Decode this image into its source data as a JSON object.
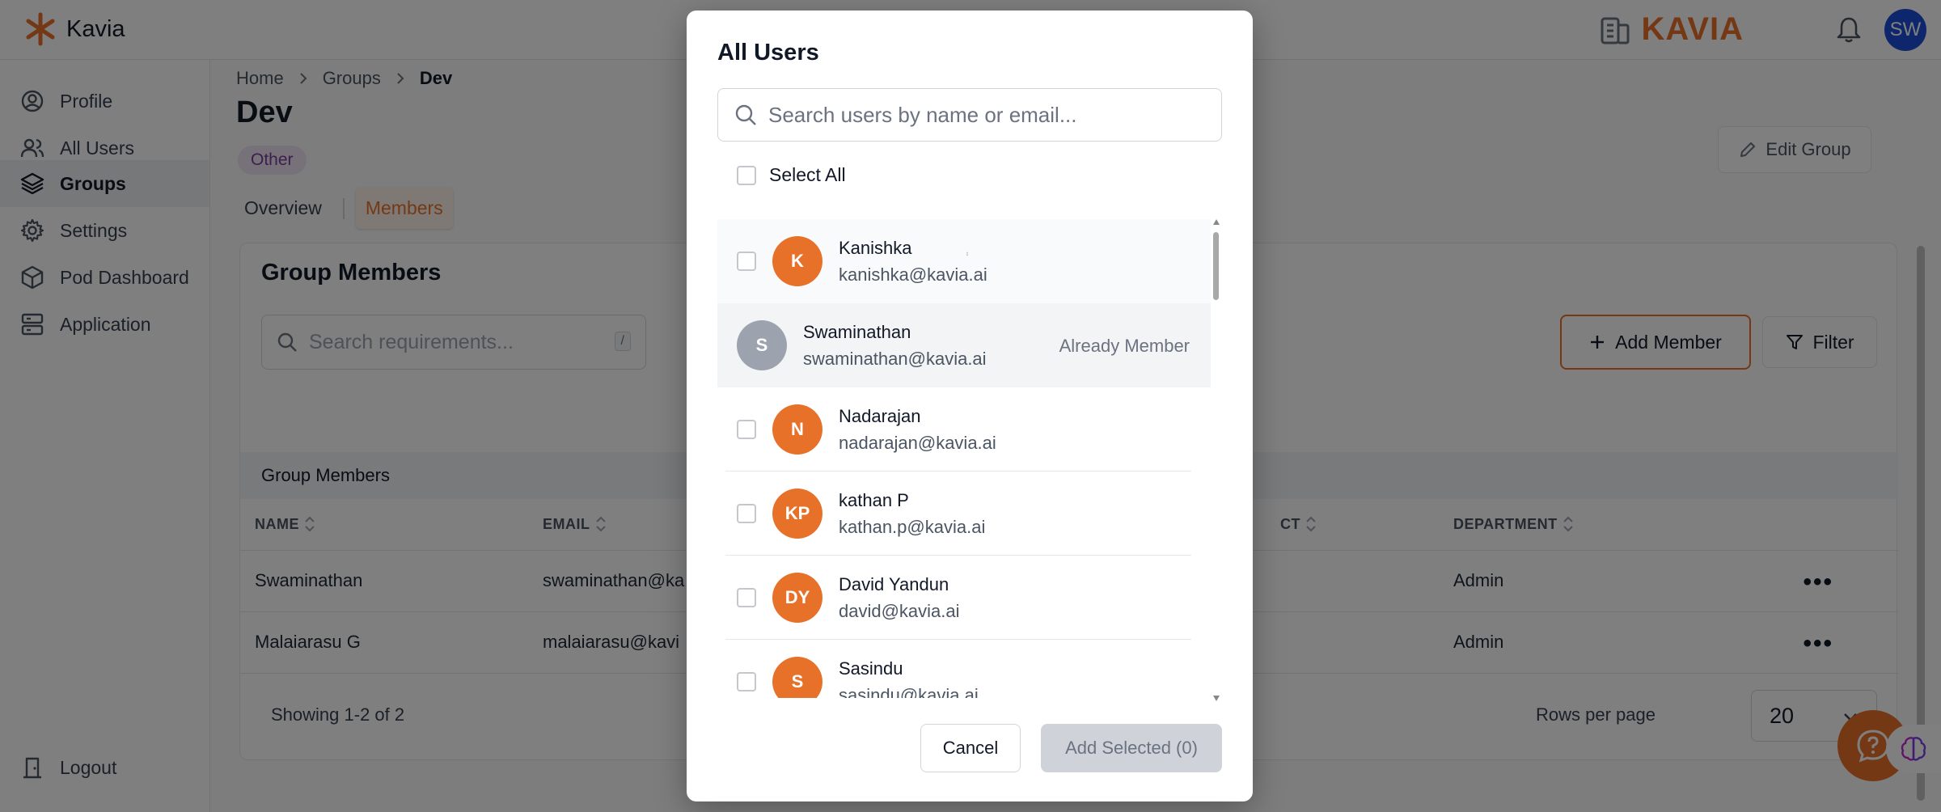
{
  "topbar": {
    "brand": "Kavia",
    "logo_text": "KAVIA",
    "avatar_initials": "SW"
  },
  "sidebar": {
    "items": [
      {
        "label": "Profile",
        "icon": "user-circle-icon"
      },
      {
        "label": "All Users",
        "icon": "users-icon"
      },
      {
        "label": "Groups",
        "icon": "layers-icon",
        "active": true
      },
      {
        "label": "Settings",
        "icon": "gear-icon"
      },
      {
        "label": "Pod Dashboard",
        "icon": "cube-icon"
      },
      {
        "label": "Application",
        "icon": "server-icon"
      }
    ],
    "logout": "Logout"
  },
  "breadcrumb": [
    "Home",
    "Groups",
    "Dev"
  ],
  "page": {
    "title": "Dev",
    "tag": "Other",
    "edit_label": "Edit Group",
    "tabs": [
      "Overview",
      "Members"
    ]
  },
  "members": {
    "title": "Group Members",
    "search_placeholder": "Search requirements...",
    "search_kbd": "/",
    "add_label": "Add Member",
    "filter_label": "Filter",
    "table_caption": "Group Members",
    "columns": [
      "NAME",
      "EMAIL",
      "CT",
      "DEPARTMENT"
    ],
    "rows": [
      {
        "name": "Swaminathan",
        "email": "swaminathan@ka",
        "department": "Admin"
      },
      {
        "name": "Malaiarasu G",
        "email": "malaiarasu@kavi",
        "department": "Admin"
      }
    ],
    "showing": "Showing 1-2 of 2",
    "rows_per_page_label": "Rows per page",
    "rows_per_page": "20"
  },
  "modal": {
    "title": "All Users",
    "search_placeholder": "Search users by name or email...",
    "select_all": "Select All",
    "users": [
      {
        "initials": "K",
        "name": "Kanishka",
        "email": "kanishka@kavia.ai"
      },
      {
        "initials": "S",
        "name": "Swaminathan",
        "email": "swaminathan@kavia.ai",
        "status": "Already Member"
      },
      {
        "initials": "N",
        "name": "Nadarajan",
        "email": "nadarajan@kavia.ai"
      },
      {
        "initials": "KP",
        "name": "kathan P",
        "email": "kathan.p@kavia.ai"
      },
      {
        "initials": "DY",
        "name": "David Yandun",
        "email": "david@kavia.ai"
      },
      {
        "initials": "S",
        "name": "Sasindu",
        "email": "sasindu@kavia.ai"
      }
    ],
    "cancel_label": "Cancel",
    "add_selected_label": "Add Selected (0)"
  },
  "colors": {
    "accent": "#e8712a",
    "avatar_blue": "#1d4ed8",
    "member_gray": "#9ca3af"
  }
}
